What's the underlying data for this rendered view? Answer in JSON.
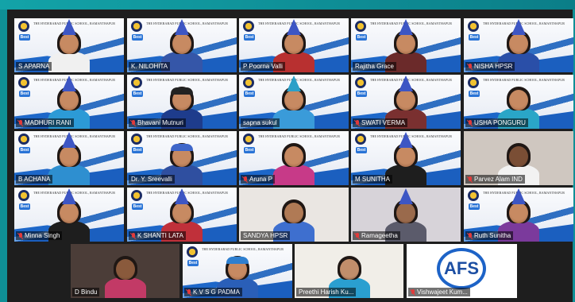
{
  "meeting": {
    "school_name": "THE HYDERABAD PUBLIC SCHOOL, RAMANTHAPUR",
    "badge_text": "Best",
    "afs_logo_text": "AFS",
    "participants": [
      {
        "name": "S APARNA",
        "muted": false
      },
      {
        "name": "K. NILOHITA",
        "muted": false,
        "active": true
      },
      {
        "name": "P Poorna Valli",
        "muted": false
      },
      {
        "name": "Rajitha Grace",
        "muted": false
      },
      {
        "name": "NISHA HPSR",
        "muted": true
      },
      {
        "name": "MADHURI RANI",
        "muted": true
      },
      {
        "name": "Bhavani Mutnuri",
        "muted": true
      },
      {
        "name": "sapna sukul",
        "muted": false
      },
      {
        "name": "SWATI VERMA",
        "muted": true
      },
      {
        "name": "USHA PONGURU",
        "muted": true
      },
      {
        "name": "B ACHANA",
        "muted": false
      },
      {
        "name": "Dr. Y. Sreevalli",
        "muted": false
      },
      {
        "name": "Aruna P",
        "muted": true
      },
      {
        "name": "M SUNITHA",
        "muted": false
      },
      {
        "name": "Parvez Alam IND",
        "muted": true
      },
      {
        "name": "Minna Singh",
        "muted": true
      },
      {
        "name": "K SHANTI LATA",
        "muted": true
      },
      {
        "name": "SANDYA HPSR",
        "muted": false
      },
      {
        "name": "Ramageetha",
        "muted": true
      },
      {
        "name": "Ruth Sunitha",
        "muted": true
      },
      {
        "name": "D Bindu",
        "muted": false
      },
      {
        "name": "K V S G PADMA",
        "muted": true
      },
      {
        "name": "Preethi Harish Ku...",
        "muted": false
      },
      {
        "name": "Vishwajeet Kum...",
        "muted": true
      }
    ]
  }
}
